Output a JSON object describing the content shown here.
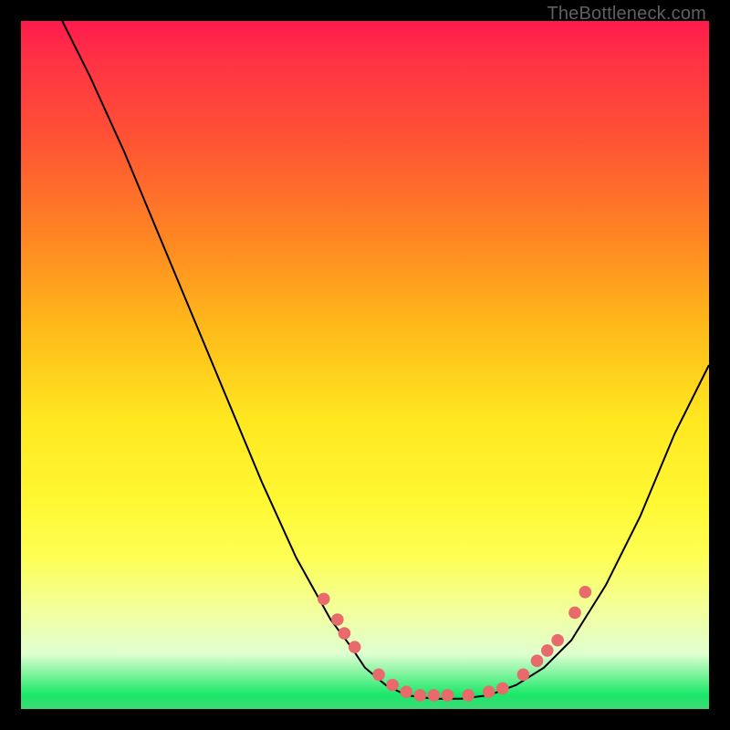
{
  "attribution": "TheBottleneck.com",
  "chart_data": {
    "type": "line",
    "title": "",
    "xlabel": "",
    "ylabel": "",
    "xlim": [
      0,
      100
    ],
    "ylim": [
      0,
      100
    ],
    "curve": [
      {
        "x": 6,
        "y": 100
      },
      {
        "x": 10,
        "y": 92
      },
      {
        "x": 15,
        "y": 81
      },
      {
        "x": 20,
        "y": 69
      },
      {
        "x": 25,
        "y": 57
      },
      {
        "x": 30,
        "y": 45
      },
      {
        "x": 35,
        "y": 33
      },
      {
        "x": 40,
        "y": 22
      },
      {
        "x": 45,
        "y": 13
      },
      {
        "x": 48,
        "y": 9
      },
      {
        "x": 50,
        "y": 6
      },
      {
        "x": 53,
        "y": 3.5
      },
      {
        "x": 56,
        "y": 2
      },
      {
        "x": 60,
        "y": 1.5
      },
      {
        "x": 64,
        "y": 1.5
      },
      {
        "x": 68,
        "y": 2
      },
      {
        "x": 72,
        "y": 3.5
      },
      {
        "x": 76,
        "y": 6
      },
      {
        "x": 80,
        "y": 10
      },
      {
        "x": 85,
        "y": 18
      },
      {
        "x": 90,
        "y": 28
      },
      {
        "x": 95,
        "y": 40
      },
      {
        "x": 100,
        "y": 50
      }
    ],
    "dots": [
      {
        "x": 44,
        "y": 16
      },
      {
        "x": 46,
        "y": 13
      },
      {
        "x": 47,
        "y": 11
      },
      {
        "x": 48.5,
        "y": 9
      },
      {
        "x": 52,
        "y": 5
      },
      {
        "x": 54,
        "y": 3.5
      },
      {
        "x": 56,
        "y": 2.5
      },
      {
        "x": 58,
        "y": 2
      },
      {
        "x": 60,
        "y": 2
      },
      {
        "x": 62,
        "y": 2
      },
      {
        "x": 65,
        "y": 2
      },
      {
        "x": 68,
        "y": 2.5
      },
      {
        "x": 70,
        "y": 3
      },
      {
        "x": 73,
        "y": 5
      },
      {
        "x": 75,
        "y": 7
      },
      {
        "x": 76.5,
        "y": 8.5
      },
      {
        "x": 78,
        "y": 10
      },
      {
        "x": 80.5,
        "y": 14
      },
      {
        "x": 82,
        "y": 17
      }
    ],
    "dot_color": "#e86a6a",
    "curve_color": "#000000"
  }
}
